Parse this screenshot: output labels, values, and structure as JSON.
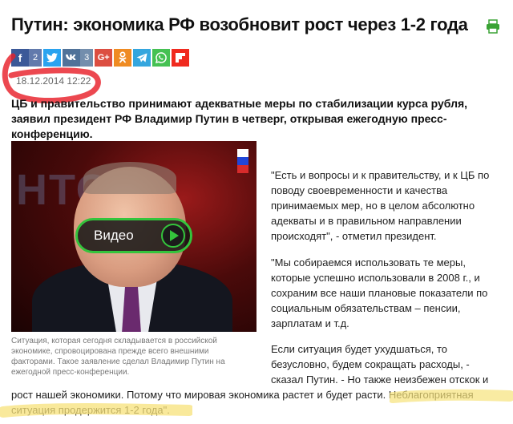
{
  "article": {
    "title": "Путин: экономика РФ возобновит рост через 1-2 года",
    "date": "18.12.2014 12:22",
    "lead": "ЦБ и правительство принимают адекватные меры по стабилизации курса рубля, заявил президент РФ Владимир Путин в четверг, открывая ежегодную пресс-конференцию.",
    "quote1": "\"Есть и вопросы и к правительству, и к ЦБ по поводу своевременности и качества принимаемых мер, но в целом абсолютно адекваты и в правильном направлении происходят\", - отметил президент.",
    "quote2": "\"Мы собираемся использовать те меры, которые успешно использовали в 2008 г., и сохраним все наши плановые показатели по социальным обязательствам – пенсии, зарплатам и т.д.",
    "quote3": "Если ситуация будет ухудшаться, то безусловно, будем сокращать расходы, - сказал Путин. - Но также неизбежен отскок и",
    "tail": "рост нашей экономики. Потому что мировая экономика растет и будет расти. Неблагоприятная ситуация продержится 1-2 года\"."
  },
  "share": {
    "facebook_label": "f",
    "facebook_count": "2",
    "twitter_label": "t",
    "vk_label": "vk",
    "vk_count": "3",
    "gplus_label": "G+",
    "ok_label": "ok",
    "telegram_label": "tg",
    "whatsapp_label": "wa",
    "flipboard_label": "f"
  },
  "video": {
    "play_label": "Видео",
    "background_text": "НТО",
    "caption": "Ситуация, которая сегодня складывается в российской экономике, спровоцирована прежде всего внешними факторами. Такое заявление сделал Владимир Путин на ежегодной пресс-конференции."
  },
  "colors": {
    "highlight_red": "#e8202a",
    "highlight_yellow": "#f7e27a",
    "play_green": "#34c43c"
  }
}
